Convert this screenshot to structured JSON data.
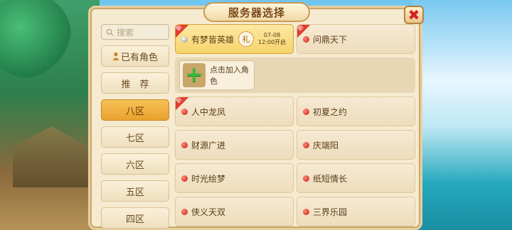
{
  "dialog": {
    "title": "服务器选择",
    "close_label": "✖"
  },
  "sidebar": {
    "search_placeholder": "搜索",
    "items": [
      {
        "label": "已有角色",
        "icon": "person-icon"
      },
      {
        "label": "推　荐"
      },
      {
        "label": "八区",
        "active": true
      },
      {
        "label": "七区"
      },
      {
        "label": "六区"
      },
      {
        "label": "五区"
      },
      {
        "label": "四区"
      }
    ]
  },
  "recommended": {
    "featured": {
      "name": "有梦皆英雄",
      "new": "新",
      "gift_label": "礼",
      "open_date": "07-08",
      "open_time": "12:00开启"
    },
    "second": {
      "name": "问鼎天下",
      "new": "新"
    }
  },
  "add_role": {
    "label": "点击加入角色"
  },
  "servers": [
    {
      "name": "人中龙凤",
      "new": "新"
    },
    {
      "name": "初夏之约"
    },
    {
      "name": "财源广进"
    },
    {
      "name": "庆端阳"
    },
    {
      "name": "时光绘梦"
    },
    {
      "name": "纸短情长"
    },
    {
      "name": "侠义天双"
    },
    {
      "name": "三界乐园"
    }
  ]
}
